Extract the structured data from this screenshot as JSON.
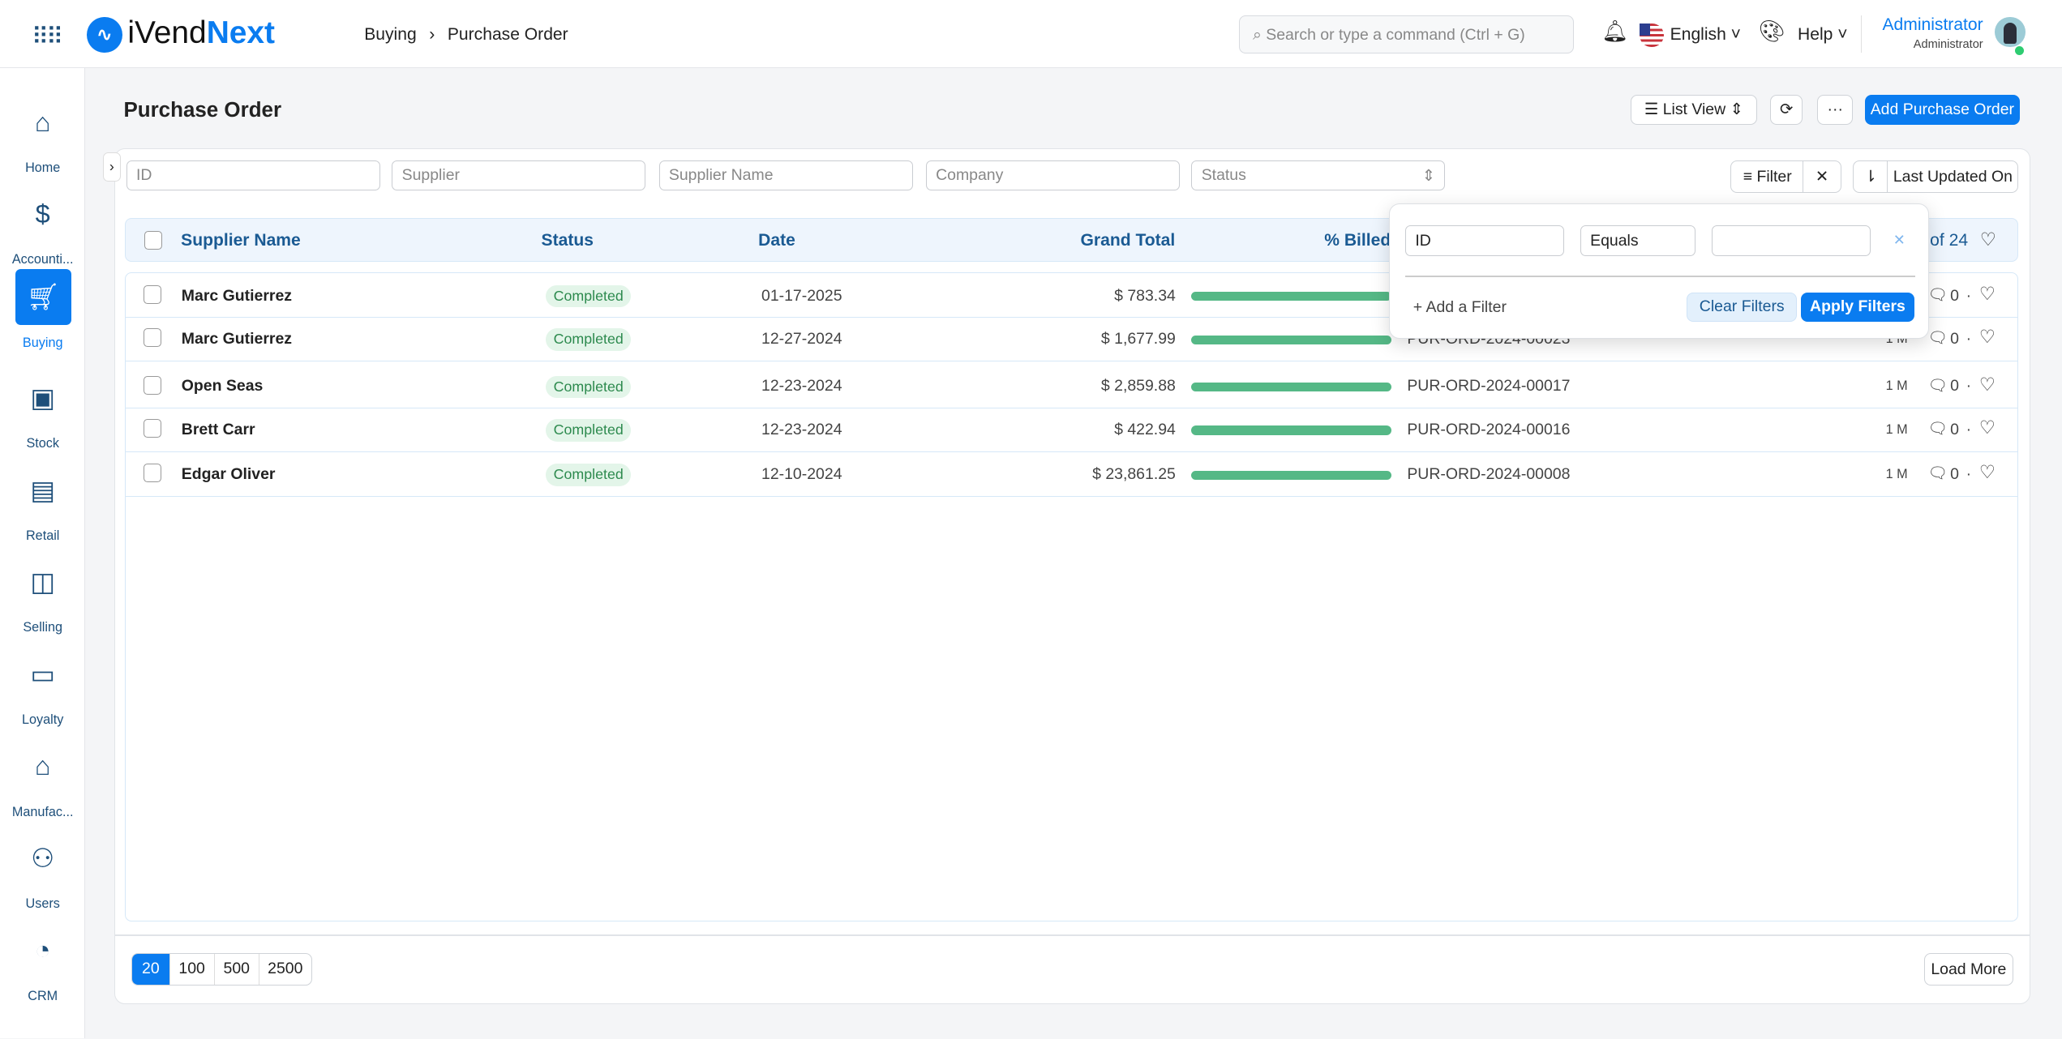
{
  "app": {
    "logo_prefix": "iVend",
    "logo_suffix": "Next"
  },
  "breadcrumb": [
    "Buying",
    "Purchase Order"
  ],
  "search": {
    "placeholder": "Search or type a command (Ctrl + G)"
  },
  "header": {
    "language": "English",
    "help": "Help",
    "user_name": "Administrator",
    "user_role": "Administrator"
  },
  "sidebar": {
    "items": [
      {
        "label": "Home",
        "icon": "home-icon"
      },
      {
        "label": "Accounti...",
        "icon": "dollar-icon"
      },
      {
        "label": "Buying",
        "icon": "cart-icon",
        "active": true
      },
      {
        "label": "Stock",
        "icon": "box-icon"
      },
      {
        "label": "Retail",
        "icon": "pos-icon"
      },
      {
        "label": "Selling",
        "icon": "bag-icon"
      },
      {
        "label": "Loyalty",
        "icon": "id-card-icon"
      },
      {
        "label": "Manufac...",
        "icon": "factory-icon"
      },
      {
        "label": "Users",
        "icon": "users-icon"
      },
      {
        "label": "CRM",
        "icon": "pie-icon"
      }
    ]
  },
  "page": {
    "title": "Purchase Order",
    "list_view": "List View",
    "add_button": "Add Purchase Order"
  },
  "filters": {
    "id": "ID",
    "supplier": "Supplier",
    "supplier_name": "Supplier Name",
    "company": "Company",
    "status": "Status",
    "filter_button": "Filter",
    "sort_label": "Last Updated On"
  },
  "table": {
    "columns": [
      "Supplier Name",
      "Status",
      "Date",
      "Grand Total",
      "% Billed"
    ],
    "count": "of 24",
    "rows": [
      {
        "supplier": "Marc Gutierrez",
        "status": "Completed",
        "date": "01-17-2025",
        "total": "$ 783.34",
        "billed": 100,
        "id": "",
        "age": "",
        "comments": "0"
      },
      {
        "supplier": "Marc Gutierrez",
        "status": "Completed",
        "date": "12-27-2024",
        "total": "$ 1,677.99",
        "billed": 100,
        "id": "PUR-ORD-2024-00023",
        "age": "1 M",
        "comments": "0"
      },
      {
        "supplier": "Open Seas",
        "status": "Completed",
        "date": "12-23-2024",
        "total": "$ 2,859.88",
        "billed": 100,
        "id": "PUR-ORD-2024-00017",
        "age": "1 M",
        "comments": "0"
      },
      {
        "supplier": "Brett Carr",
        "status": "Completed",
        "date": "12-23-2024",
        "total": "$ 422.94",
        "billed": 100,
        "id": "PUR-ORD-2024-00016",
        "age": "1 M",
        "comments": "0"
      },
      {
        "supplier": "Edgar Oliver",
        "status": "Completed",
        "date": "12-10-2024",
        "total": "$ 23,861.25",
        "billed": 100,
        "id": "PUR-ORD-2024-00008",
        "age": "1 M",
        "comments": "0"
      }
    ]
  },
  "filter_popup": {
    "field": "ID",
    "operator": "Equals",
    "value": "",
    "add": "+ Add a Filter",
    "clear": "Clear Filters",
    "apply": "Apply Filters"
  },
  "footer": {
    "page_sizes": [
      "20",
      "100",
      "500",
      "2500"
    ],
    "selected": "20",
    "load_more": "Load More"
  },
  "colors": {
    "accent": "#0a7cf0",
    "success": "#55b886"
  }
}
